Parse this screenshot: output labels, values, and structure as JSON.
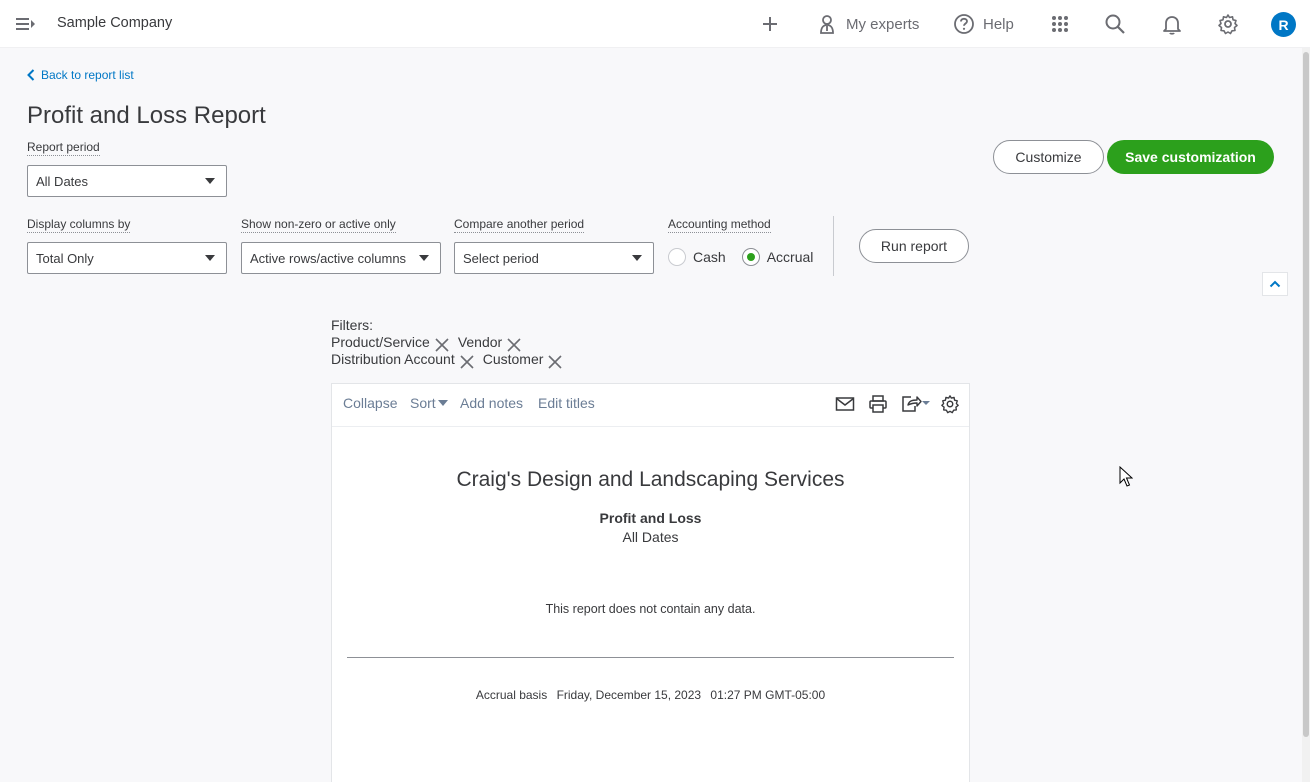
{
  "topbar": {
    "company_name": "Sample Company",
    "actions": {
      "new_label": "+",
      "experts_label": "My experts",
      "help_label": "Help"
    },
    "avatar_initial": "R",
    "colors": {
      "avatar_bg": "#0077c5"
    }
  },
  "header": {
    "back_link": "Back to report list",
    "title": "Profit and Loss Report"
  },
  "controls": {
    "report_period": {
      "label": "Report period",
      "value": "All Dates"
    },
    "display_columns": {
      "label": "Display columns by",
      "value": "Total Only"
    },
    "non_zero": {
      "label": "Show non-zero or active only",
      "value": "Active rows/active columns"
    },
    "compare_period": {
      "label": "Compare another period",
      "value": "Select period"
    },
    "accounting_method": {
      "label": "Accounting method",
      "options": [
        "Cash",
        "Accrual"
      ],
      "selected": "Accrual"
    },
    "customize_label": "Customize",
    "save_label": "Save customization",
    "run_label": "Run report",
    "colors": {
      "primary": "#2ca01c"
    }
  },
  "filters": {
    "title": "Filters:",
    "row1": [
      "Product/Service",
      "Vendor"
    ],
    "row2": [
      "Distribution Account",
      "Customer"
    ]
  },
  "report": {
    "toolbar": {
      "collapse": "Collapse",
      "sort": "Sort",
      "add_notes": "Add notes",
      "edit_titles": "Edit titles",
      "icons": [
        "email-icon",
        "print-icon",
        "export-icon",
        "settings-icon"
      ]
    },
    "company": "Craig's Design and Landscaping Services",
    "name": "Profit and Loss",
    "period": "All Dates",
    "empty_message": "This report does not contain any data.",
    "footer": {
      "basis": "Accrual basis",
      "date": "Friday, December 15, 2023",
      "time": "01:27 PM GMT-05:00"
    }
  }
}
